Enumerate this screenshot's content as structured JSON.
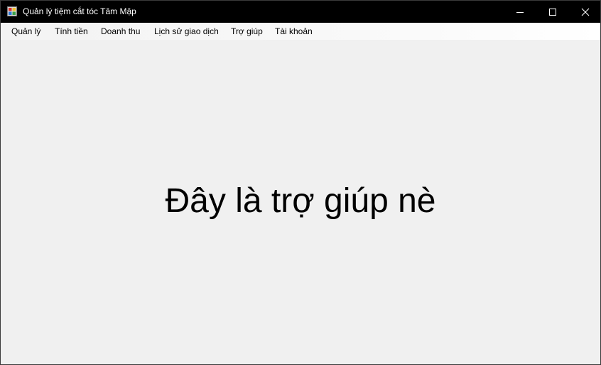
{
  "window": {
    "title": "Quản lý tiệm cắt tóc Tâm Mập",
    "icon": "app-icon"
  },
  "caption_buttons": {
    "minimize_icon": "minimize-icon",
    "maximize_icon": "maximize-icon",
    "close_icon": "close-icon"
  },
  "menu": {
    "items": [
      {
        "label": "Quản lý"
      },
      {
        "label": "Tính tiền"
      },
      {
        "label": "Doanh thu"
      },
      {
        "label": "Lịch sử giao dịch"
      },
      {
        "label": "Trợ giúp"
      },
      {
        "label": "Tài khoản"
      }
    ]
  },
  "content": {
    "help_message": "Đây là trợ giúp nè"
  },
  "colors": {
    "titlebar_bg": "#000000",
    "client_bg": "#f0f0f0",
    "text": "#000000"
  }
}
